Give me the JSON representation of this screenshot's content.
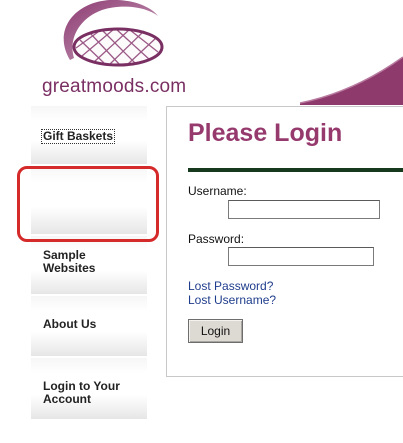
{
  "logo": {
    "text": "greatmoods.com",
    "icon": "basket-logo-icon"
  },
  "colors": {
    "brand_purple": "#963a6e",
    "logo_purple": "#7a2f63",
    "rule_green": "#173a1e",
    "link_blue": "#1f3d8c",
    "highlight_red": "#d42a2a"
  },
  "sidebar": {
    "items": [
      {
        "label": "Gift Baskets"
      },
      {
        "label": ""
      },
      {
        "label": "Sample Websites"
      },
      {
        "label": "About Us"
      },
      {
        "label": "Login to Your Account"
      }
    ]
  },
  "login": {
    "title": "Please Login",
    "username_label": "Username:",
    "username_value": "",
    "password_label": "Password:",
    "password_value": "",
    "lost_password": "Lost Password?",
    "lost_username": "Lost Username?",
    "button_label": "Login"
  }
}
